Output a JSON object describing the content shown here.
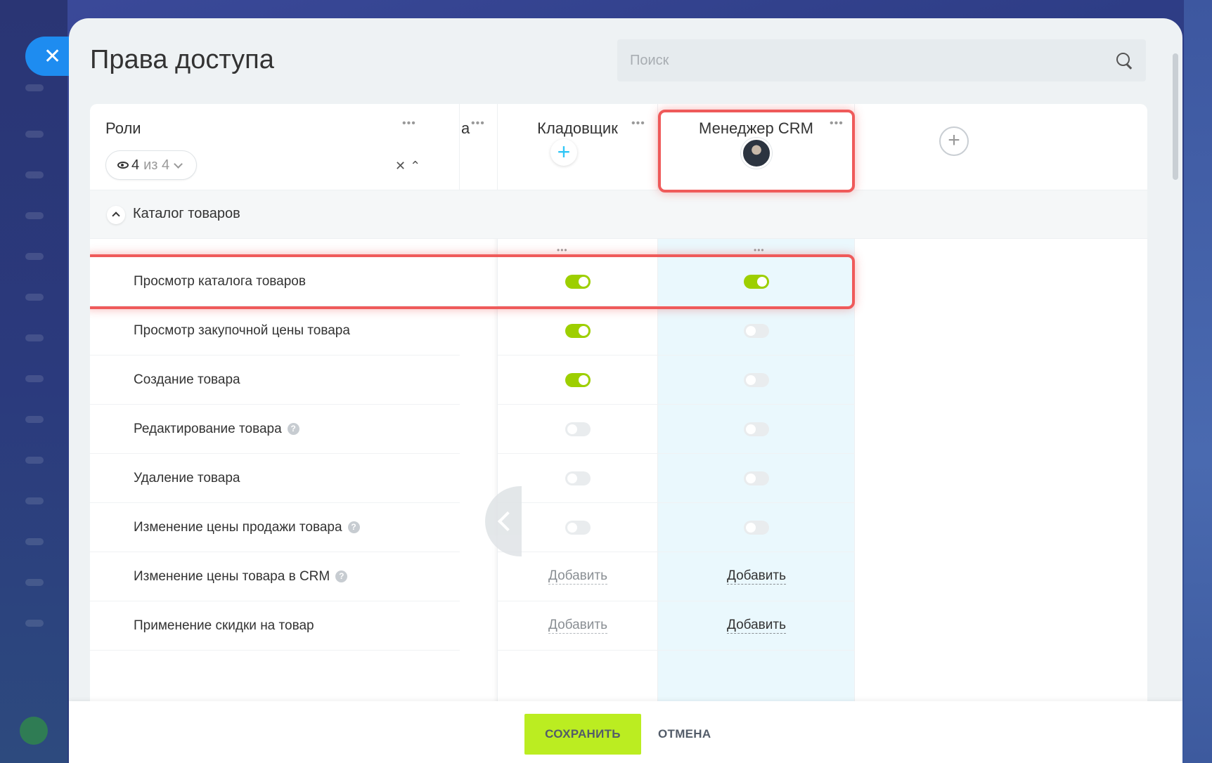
{
  "page": {
    "title": "Права доступа"
  },
  "search": {
    "placeholder": "Поиск"
  },
  "roles_header": {
    "label": "Роли",
    "count_visible": "4",
    "count_of": "из 4"
  },
  "columns": [
    {
      "label": "а"
    },
    {
      "label": "Кладовщик"
    },
    {
      "label": "Менеджер CRM"
    }
  ],
  "section": {
    "label": "Каталог товаров"
  },
  "permissions": [
    {
      "label": "Просмотр каталога товаров",
      "help": false,
      "kladovshik": "on",
      "manager": "on"
    },
    {
      "label": "Просмотр закупочной цены товара",
      "help": false,
      "kladovshik": "on",
      "manager": "off"
    },
    {
      "label": "Создание товара",
      "help": false,
      "kladovshik": "on",
      "manager": "off"
    },
    {
      "label": "Редактирование товара",
      "help": true,
      "kladovshik": "off",
      "manager": "off"
    },
    {
      "label": "Удаление товара",
      "help": false,
      "kladovshik": "off",
      "manager": "off"
    },
    {
      "label": "Изменение цены продажи товара",
      "help": true,
      "kladovshik": "off",
      "manager": "off"
    },
    {
      "label": "Изменение цены товара в CRM",
      "help": true,
      "kladovshik": "Добавить",
      "manager": "Добавить"
    },
    {
      "label": "Применение скидки на товар",
      "help": false,
      "kladovshik": "Добавить",
      "manager": "Добавить"
    }
  ],
  "footer": {
    "save_label": "СОХРАНИТЬ",
    "cancel_label": "ОТМЕНА"
  },
  "colors": {
    "accent_green": "#bbed21",
    "toggle_on": "#9dcf00",
    "highlight": "#ef5a5a",
    "selected_column": "#eaf8fd",
    "close_button": "#1e8cf0"
  },
  "icons": {
    "close": "close-icon",
    "search": "search-icon",
    "eye": "eye-icon",
    "help": "help-icon"
  }
}
